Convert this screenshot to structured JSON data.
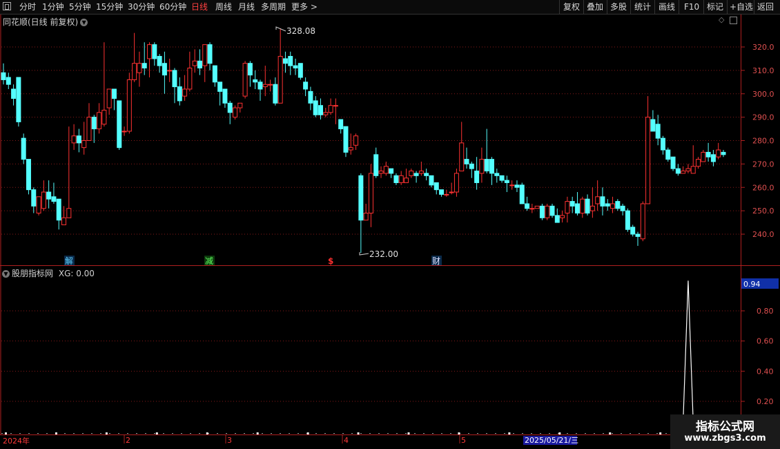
{
  "toolbar": {
    "periods": [
      "分时",
      "1分钟",
      "5分钟",
      "15分钟",
      "30分钟",
      "60分钟",
      "日线",
      "周线",
      "月线",
      "多周期",
      "更多 >"
    ],
    "active_period": "日线",
    "right_buttons": [
      "复权",
      "叠加",
      "多股",
      "统计",
      "画线",
      "F10",
      "标记",
      "+自选",
      "返回"
    ]
  },
  "main_panel": {
    "title": "同花顺(日线 前复权)",
    "y_axis_ticks": [
      "320.0",
      "310.0",
      "300.0",
      "290.0",
      "280.0",
      "270.0",
      "260.0",
      "250.0",
      "240.0"
    ],
    "high_label": "328.08",
    "low_label": "232.00",
    "event_markers": [
      "解",
      "减",
      "$",
      "财"
    ]
  },
  "indicator_panel": {
    "title": "股朋指标网",
    "xg_label": "XG: 0.00",
    "current_value": "0.94",
    "y_axis_ticks": [
      "0.80",
      "0.60",
      "0.40",
      "0.20"
    ]
  },
  "date_axis": {
    "year_label": "2024年",
    "month_labels": [
      "2",
      "3",
      "4",
      "5"
    ],
    "cursor_date": "2025/05/21/三"
  },
  "watermark": {
    "line1": "指标公式网",
    "line2": "www.zbgs3.com"
  },
  "chart_data": {
    "type": "candlestick",
    "y_range": [
      230,
      333
    ],
    "up_color": "#ff3232",
    "down_color": "#54ffff",
    "candles": [
      [
        309,
        306,
        313,
        304
      ],
      [
        307,
        304,
        309,
        302
      ],
      [
        302,
        298,
        304,
        295
      ],
      [
        307,
        288,
        307,
        286
      ],
      [
        281,
        272,
        283,
        270
      ],
      [
        272,
        259,
        272,
        257
      ],
      [
        259,
        252,
        260,
        249
      ],
      [
        249,
        256,
        256,
        248
      ],
      [
        251,
        258,
        263,
        250
      ],
      [
        258,
        255,
        263,
        251
      ],
      [
        256,
        254,
        262,
        253
      ],
      [
        255,
        246,
        255,
        242
      ],
      [
        244,
        247,
        252,
        244
      ],
      [
        247,
        251,
        286,
        250
      ],
      [
        279,
        282,
        287,
        276
      ],
      [
        282,
        279,
        285,
        275
      ],
      [
        277,
        280,
        288,
        274
      ],
      [
        280,
        290,
        296,
        280
      ],
      [
        290,
        285,
        291,
        279
      ],
      [
        285,
        292,
        296,
        283
      ],
      [
        287,
        293,
        322,
        286
      ],
      [
        294,
        302,
        300,
        291
      ],
      [
        302,
        298,
        302,
        293
      ],
      [
        297,
        277,
        297,
        276
      ],
      [
        284,
        284,
        286,
        282
      ],
      [
        284,
        306,
        309,
        283
      ],
      [
        306,
        313,
        326,
        305
      ],
      [
        309,
        313,
        318,
        303
      ],
      [
        313,
        311,
        322,
        308
      ],
      [
        315,
        321,
        322,
        307
      ],
      [
        321,
        315,
        322,
        312
      ],
      [
        316,
        312,
        317,
        309
      ],
      [
        313,
        308,
        318,
        300
      ],
      [
        310,
        310,
        315,
        305
      ],
      [
        310,
        303,
        311,
        296
      ],
      [
        303,
        297,
        307,
        295
      ],
      [
        299,
        302,
        308,
        297
      ],
      [
        302,
        311,
        318,
        301
      ],
      [
        312,
        314,
        319,
        309
      ],
      [
        314,
        311,
        319,
        308
      ],
      [
        312,
        321,
        321,
        305
      ],
      [
        321,
        313,
        322,
        310
      ],
      [
        312,
        305,
        312,
        303
      ],
      [
        305,
        301,
        305,
        295
      ],
      [
        302,
        296,
        302,
        294
      ],
      [
        296,
        292,
        297,
        287
      ],
      [
        290,
        294,
        295,
        289
      ],
      [
        294,
        296,
        296,
        292
      ],
      [
        299,
        313,
        314,
        298
      ],
      [
        313,
        308,
        314,
        303
      ],
      [
        306,
        305,
        310,
        302
      ],
      [
        305,
        302,
        306,
        297
      ],
      [
        303,
        304,
        312,
        299
      ],
      [
        304,
        304,
        306,
        301
      ],
      [
        304,
        296,
        307,
        295
      ],
      [
        296,
        316,
        328,
        296
      ],
      [
        315,
        313,
        318,
        309
      ],
      [
        316,
        312,
        318,
        308
      ],
      [
        312,
        311,
        315,
        308
      ],
      [
        313,
        307,
        313,
        306
      ],
      [
        305,
        302,
        307,
        299
      ],
      [
        301,
        296,
        303,
        293
      ],
      [
        297,
        291,
        299,
        290
      ],
      [
        295,
        291,
        298,
        289
      ],
      [
        291,
        292,
        294,
        290
      ],
      [
        292,
        295,
        298,
        291
      ],
      [
        295,
        295,
        298,
        287
      ],
      [
        289,
        285,
        289,
        283
      ],
      [
        286,
        275,
        286,
        273
      ],
      [
        276,
        277,
        283,
        274
      ],
      [
        278,
        282,
        283,
        276
      ],
      [
        265,
        246,
        266,
        232
      ],
      [
        246,
        249,
        253,
        246
      ],
      [
        249,
        266,
        270,
        243
      ],
      [
        274,
        265,
        277,
        264
      ],
      [
        266,
        267,
        269,
        264
      ],
      [
        266,
        269,
        271,
        265
      ],
      [
        268,
        266,
        268,
        264
      ],
      [
        265,
        262,
        266,
        261
      ],
      [
        262,
        265,
        267,
        261
      ],
      [
        262,
        264,
        268,
        263
      ],
      [
        265,
        267,
        268,
        264
      ],
      [
        266,
        265,
        267,
        262
      ],
      [
        266,
        267,
        271,
        265
      ],
      [
        266,
        265,
        268,
        263
      ],
      [
        265,
        261,
        265,
        260
      ],
      [
        262,
        259,
        262,
        257
      ],
      [
        259,
        257,
        259,
        256
      ],
      [
        257,
        257,
        259,
        256
      ],
      [
        258,
        258,
        262,
        257
      ],
      [
        258,
        266,
        268,
        256
      ],
      [
        267,
        279,
        288,
        267
      ],
      [
        272,
        270,
        277,
        268
      ],
      [
        270,
        268,
        271,
        264
      ],
      [
        267,
        262,
        273,
        259
      ],
      [
        266,
        272,
        277,
        262
      ],
      [
        272,
        267,
        285,
        266
      ],
      [
        272,
        266,
        273,
        261
      ],
      [
        266,
        265,
        268,
        262
      ],
      [
        265,
        263,
        265,
        262
      ],
      [
        263,
        262,
        265,
        258
      ],
      [
        261,
        261,
        263,
        259
      ],
      [
        261,
        260,
        263,
        258
      ],
      [
        261,
        253,
        262,
        253
      ],
      [
        253,
        251,
        256,
        250
      ],
      [
        251,
        251,
        253,
        249
      ],
      [
        251,
        252,
        252,
        251
      ],
      [
        252,
        247,
        253,
        246
      ],
      [
        247,
        252,
        253,
        246
      ],
      [
        252,
        248,
        253,
        247
      ],
      [
        248,
        245,
        251,
        245
      ],
      [
        247,
        248,
        250,
        245
      ],
      [
        249,
        254,
        256,
        245
      ],
      [
        254,
        252,
        256,
        249
      ],
      [
        253,
        249,
        258,
        248
      ],
      [
        249,
        255,
        256,
        247
      ],
      [
        255,
        249,
        257,
        248
      ],
      [
        250,
        252,
        260,
        247
      ],
      [
        253,
        256,
        263,
        250
      ],
      [
        256,
        252,
        260,
        248
      ],
      [
        253,
        252,
        255,
        250
      ],
      [
        251,
        253,
        256,
        249
      ],
      [
        254,
        251,
        255,
        250
      ],
      [
        252,
        250,
        253,
        248
      ],
      [
        250,
        242,
        251,
        241
      ],
      [
        243,
        240,
        244,
        239
      ],
      [
        240,
        239,
        241,
        235
      ],
      [
        238,
        253,
        254,
        237
      ],
      [
        253,
        290,
        299,
        253
      ],
      [
        289,
        284,
        293,
        284
      ],
      [
        287,
        281,
        291,
        278
      ],
      [
        281,
        276,
        282,
        274
      ],
      [
        276,
        272,
        277,
        271
      ],
      [
        273,
        268,
        273,
        267
      ],
      [
        268,
        266,
        270,
        265
      ],
      [
        266,
        267,
        269,
        266
      ],
      [
        267,
        268,
        270,
        266
      ],
      [
        266,
        269,
        278,
        266
      ],
      [
        269,
        272,
        273,
        268
      ],
      [
        271,
        275,
        276,
        271
      ],
      [
        275,
        273,
        279,
        271
      ],
      [
        274,
        271,
        276,
        269
      ],
      [
        273,
        276,
        279,
        272
      ],
      [
        275,
        274,
        276,
        273
      ]
    ],
    "indicator_series": {
      "name": "XG",
      "baseline_dot_value": 0.04,
      "spike_value": 1.0
    }
  }
}
